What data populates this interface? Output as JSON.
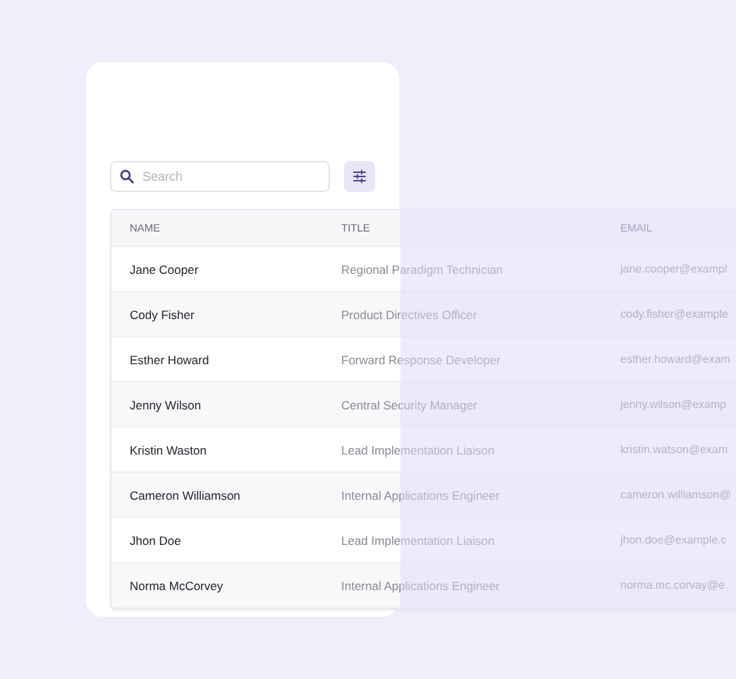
{
  "search": {
    "placeholder": "Search"
  },
  "table": {
    "columns": [
      "NAME",
      "TITLE",
      "EMAIL"
    ],
    "rows": [
      {
        "name": "Jane Cooper",
        "title": "Regional Paradigm Technician",
        "email": "jane.cooper@exampl"
      },
      {
        "name": "Cody Fisher",
        "title": "Product Directives Officer",
        "email": "cody.fisher@example"
      },
      {
        "name": "Esther Howard",
        "title": "Forward Response Developer",
        "email": "esther.howard@exam"
      },
      {
        "name": "Jenny Wilson",
        "title": "Central Security Manager",
        "email": "jenny.wilson@examp"
      },
      {
        "name": "Kristin Waston",
        "title": "Lead Implementation Liaison",
        "email": "kristin.watson@exam"
      },
      {
        "name": "Cameron Williamson",
        "title": "Internal Applications Engineer",
        "email": "cameron.williamson@"
      },
      {
        "name": "Jhon Doe",
        "title": "Lead Implementation Liaison",
        "email": "jhon.doe@example.c"
      },
      {
        "name": "Norma McCorvey",
        "title": "Internal Applications Engineer",
        "email": "norma.mc.corvay@e"
      }
    ]
  }
}
